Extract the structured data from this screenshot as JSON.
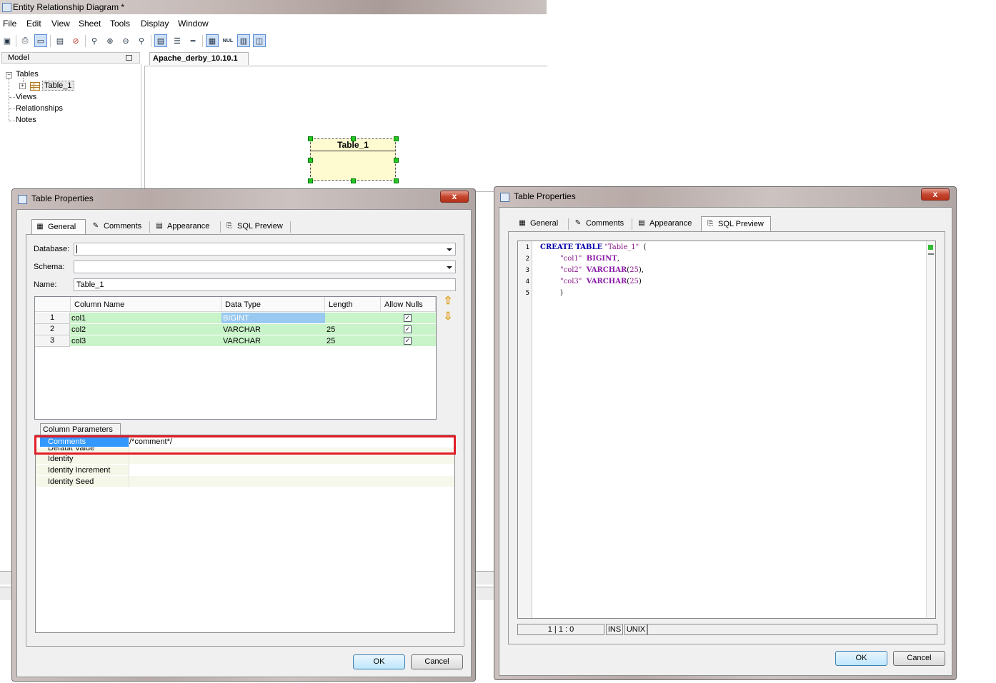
{
  "app": {
    "title": "Entity Relationship Diagram *",
    "menu": [
      "File",
      "Edit",
      "View",
      "Sheet",
      "Tools",
      "Display",
      "Window"
    ],
    "model_panel_title": "Model",
    "tree": {
      "tables": "Tables",
      "table_item": "Table_1",
      "views": "Views",
      "relationships": "Relationships",
      "notes": "Notes"
    },
    "document_tab": "Apache_derby_10.10.1",
    "entity_name": "Table_1"
  },
  "dialog_left": {
    "title": "Table Properties",
    "close": "x",
    "tabs": [
      "General",
      "Comments",
      "Appearance",
      "SQL Preview"
    ],
    "active_tab": "General",
    "labels": {
      "database": "Database:",
      "schema": "Schema:",
      "name": "Name:"
    },
    "values": {
      "database": "",
      "schema": "",
      "name": "Table_1"
    },
    "columns": {
      "headers": [
        "Column Name",
        "Data Type",
        "Length",
        "Allow Nulls"
      ],
      "rows": [
        {
          "num": "1",
          "name": "col1",
          "type": "BIGINT",
          "length": "",
          "nulls": true
        },
        {
          "num": "2",
          "name": "col2",
          "type": "VARCHAR",
          "length": "25",
          "nulls": true
        },
        {
          "num": "3",
          "name": "col3",
          "type": "VARCHAR",
          "length": "25",
          "nulls": true
        }
      ]
    },
    "params_tab": "Column Parameters",
    "params": [
      {
        "name": "Comments",
        "value": "/*comment*/"
      },
      {
        "name": "Default Value",
        "value": ""
      },
      {
        "name": "Identity",
        "value": ""
      },
      {
        "name": "Identity Increment",
        "value": ""
      },
      {
        "name": "Identity Seed",
        "value": ""
      }
    ],
    "ok": "OK",
    "cancel": "Cancel"
  },
  "dialog_right": {
    "title": "Table Properties",
    "close": "x",
    "tabs": [
      "General",
      "Comments",
      "Appearance",
      "SQL Preview"
    ],
    "active_tab": "SQL Preview",
    "sql_lines": [
      {
        "n": "1",
        "kw1": "CREATE",
        "kw2": "TABLE",
        "str": "\"Table_1\"",
        "tail": "  ("
      },
      {
        "n": "2",
        "str": "\"col1\"",
        "type": "BIGINT",
        "tail": ","
      },
      {
        "n": "3",
        "str": "\"col2\"",
        "type": "VARCHAR",
        "num": "25",
        "tail": "),"
      },
      {
        "n": "4",
        "str": "\"col3\"",
        "type": "VARCHAR",
        "num": "25",
        "tail": ")"
      },
      {
        "n": "5",
        "tail": ")"
      }
    ],
    "status": {
      "position": "1 | 1 : 0",
      "mode": "INS",
      "eol": "UNIX"
    },
    "ok": "OK",
    "cancel": "Cancel"
  }
}
